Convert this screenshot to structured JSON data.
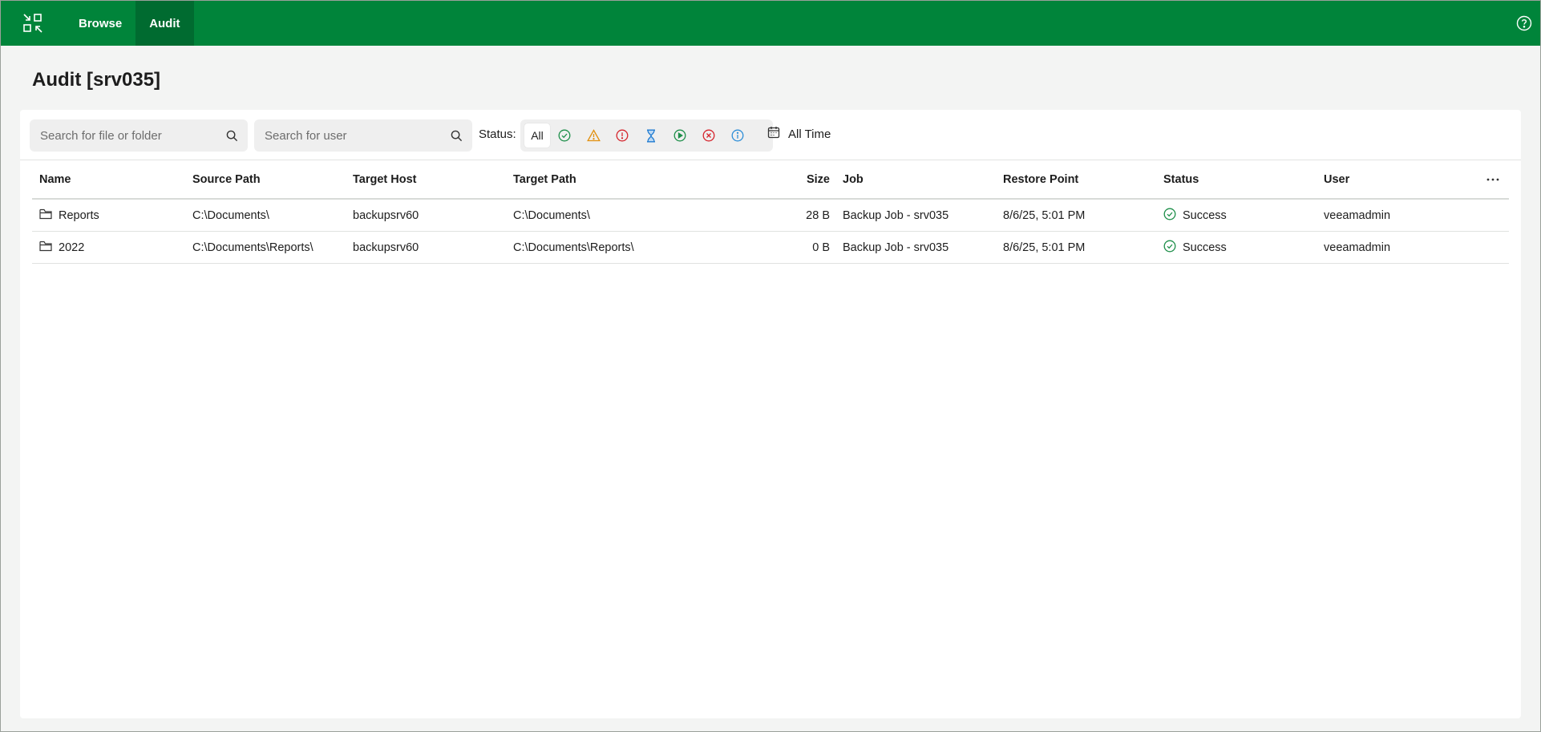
{
  "nav": {
    "app_icon": "veeam-explorer-icon",
    "tabs": [
      {
        "label": "Browse",
        "active": false
      },
      {
        "label": "Audit",
        "active": true
      }
    ],
    "help_icon": "help-circle-icon"
  },
  "page": {
    "title": "Audit [srv035]"
  },
  "toolbar": {
    "file_search_placeholder": "Search for file or folder",
    "user_search_placeholder": "Search for user",
    "status_label": "Status:",
    "status_all_label": "All",
    "status_filters": [
      "success-icon",
      "warning-icon",
      "error-icon",
      "pending-icon",
      "running-icon",
      "failed-icon",
      "info-icon"
    ],
    "date_filter_label": "All Time"
  },
  "table": {
    "columns": [
      "Name",
      "Source Path",
      "Target Host",
      "Target Path",
      "Size",
      "Job",
      "Restore Point",
      "Status",
      "User"
    ],
    "rows": [
      {
        "name": "Reports",
        "source_path": "C:\\Documents\\",
        "target_host": "backupsrv60",
        "target_path": "C:\\Documents\\",
        "size": "28 B",
        "job": "Backup Job - srv035",
        "restore_point": "8/6/25, 5:01 PM",
        "status": "Success",
        "user": "veeamadmin"
      },
      {
        "name": "2022",
        "source_path": "C:\\Documents\\Reports\\",
        "target_host": "backupsrv60",
        "target_path": "C:\\Documents\\Reports\\",
        "size": "0 B",
        "job": "Backup Job - srv035",
        "restore_point": "8/6/25, 5:01 PM",
        "status": "Success",
        "user": "veeamadmin"
      }
    ]
  },
  "colors": {
    "brand_green": "#00843a",
    "brand_green_dark": "#006b30",
    "success": "#1e8f4a",
    "warning": "#e2900f",
    "error": "#d6262e",
    "pending": "#1f7bd1",
    "info": "#2f8fd8"
  }
}
